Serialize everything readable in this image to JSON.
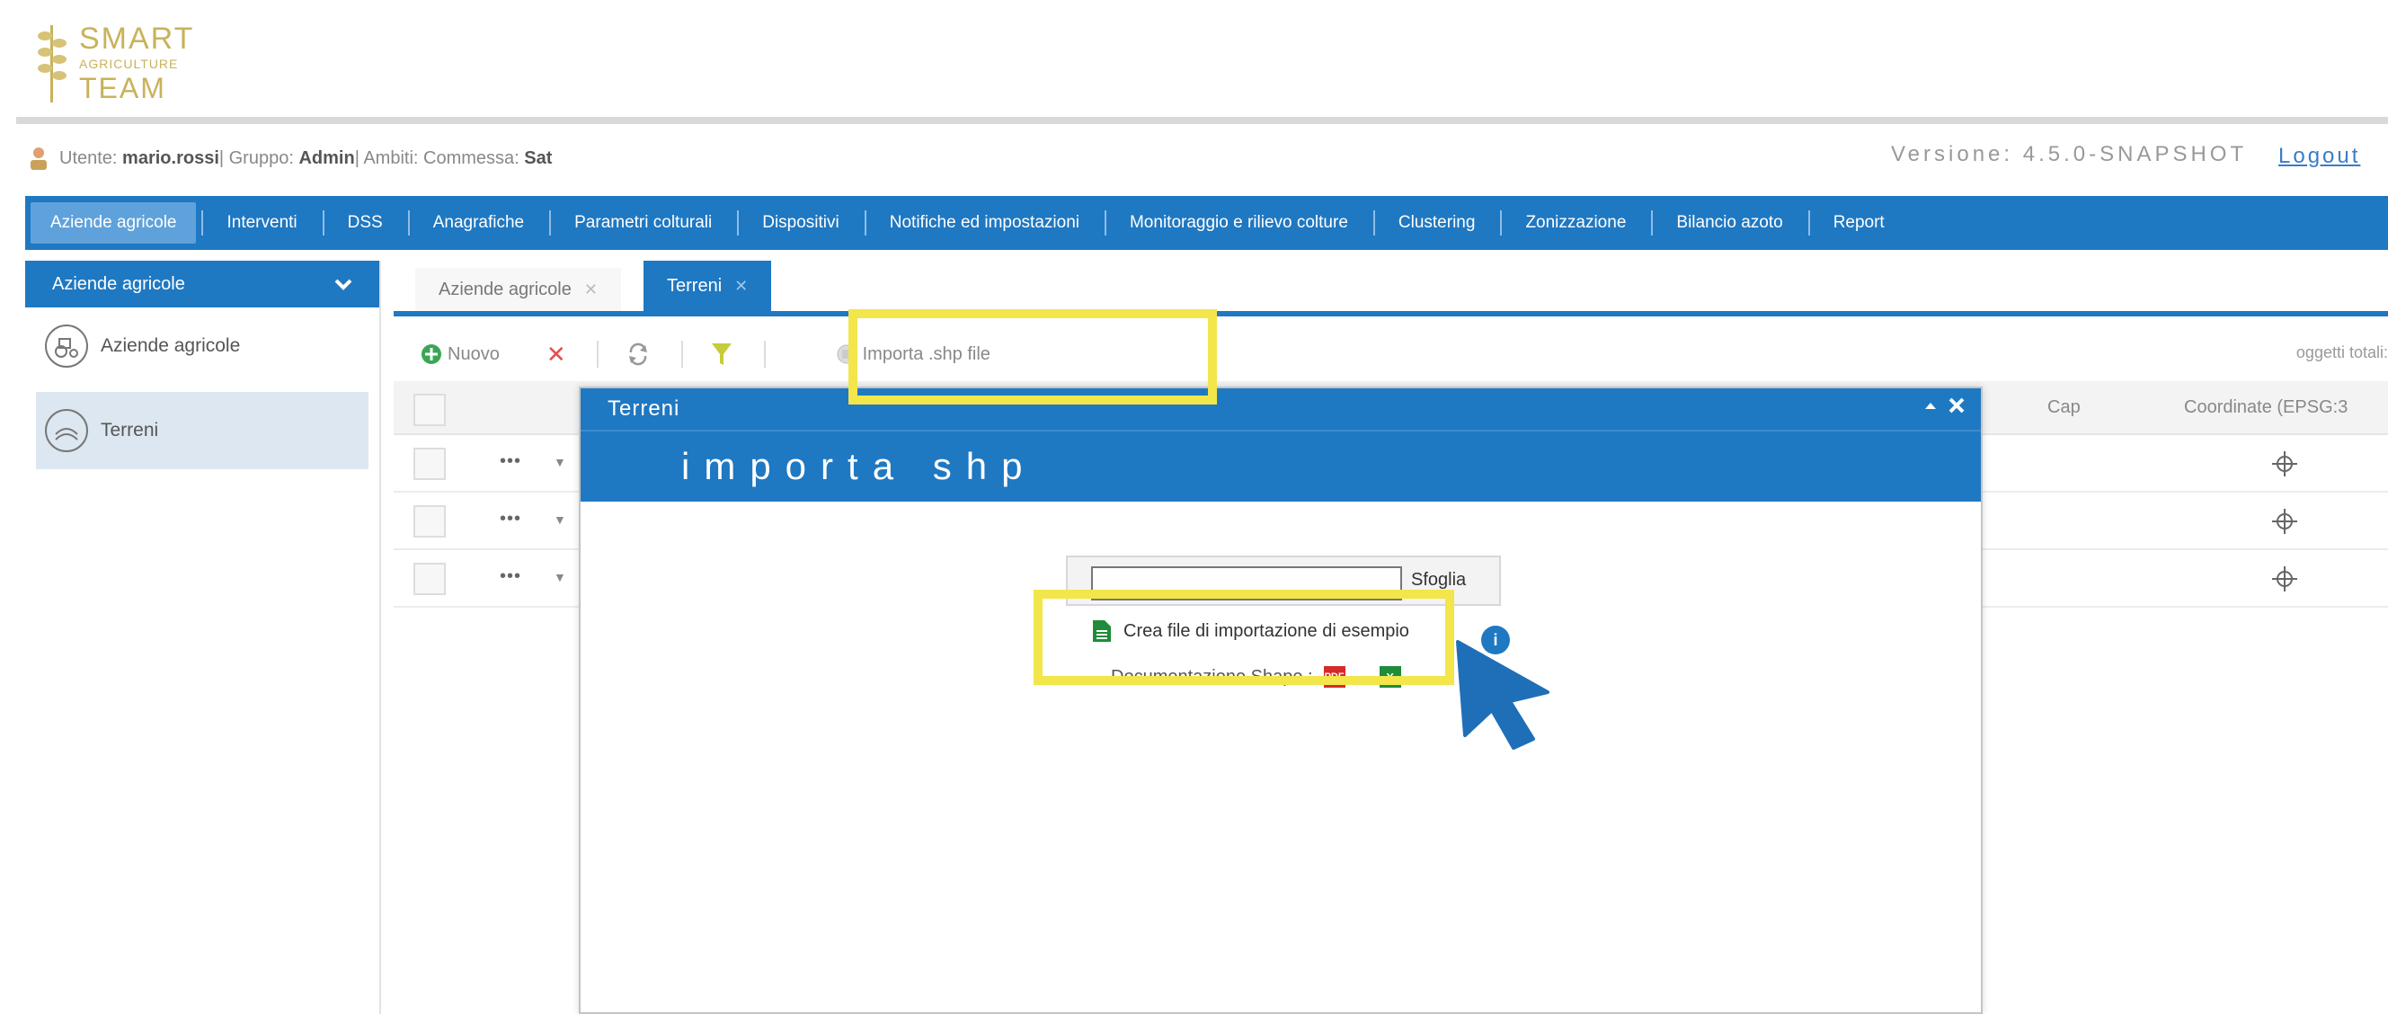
{
  "logo": {
    "line1": "SMART",
    "line2": "AGRICULTURE",
    "line3": "TEAM"
  },
  "userbar": {
    "user_label": "Utente:",
    "user_value": "mario.rossi",
    "group_label": " | Gruppo:",
    "group_value": "Admin",
    "ambiti_label": " | Ambiti: Commessa:",
    "ambiti_value": "Sat",
    "version": "Versione: 4.5.0-SNAPSHOT",
    "logout": "Logout"
  },
  "nav": {
    "items": [
      "Aziende agricole",
      "Interventi",
      "DSS",
      "Anagrafiche",
      "Parametri colturali",
      "Dispositivi",
      "Notifiche ed impostazioni",
      "Monitoraggio e rilievo colture",
      "Clustering",
      "Zonizzazione",
      "Bilancio azoto",
      "Report"
    ]
  },
  "sidebar": {
    "header": "Aziende agricole",
    "items": [
      {
        "label": "Aziende agricole"
      },
      {
        "label": "Terreni"
      }
    ]
  },
  "tabs": [
    {
      "label": "Aziende agricole"
    },
    {
      "label": "Terreni"
    }
  ],
  "toolbar": {
    "new_label": "Nuovo",
    "import_label": "Importa .shp file",
    "oggetti_label": "oggetti totali:"
  },
  "grid": {
    "columns": {
      "cap": "Cap",
      "coord": "Coordinate (EPSG:3"
    },
    "rows": [
      {
        "actions": "•••"
      },
      {
        "actions": "•••"
      },
      {
        "actions": "•••"
      }
    ]
  },
  "dialog": {
    "title": "Terreni",
    "banner": "importa shp",
    "file_value": "",
    "browse_label": "Sfoglia",
    "create_example_label": "Crea file di importazione di esempio",
    "info_label": "i",
    "doc_label": "Documentazione Shape :"
  },
  "colors": {
    "primary": "#1f78c2",
    "highlight": "#f2e64a",
    "nav_active": "#5fa2db",
    "sidebar_selected": "#dde7f1"
  },
  "icons": {
    "new": "plus-circle-icon",
    "delete": "x-icon",
    "refresh": "refresh-icon",
    "filter": "filter-icon",
    "import": "upload-icon",
    "coordinates": "crosshair-icon",
    "sheet": "spreadsheet-icon",
    "pdf": "pdf-icon",
    "excel": "excel-icon",
    "cursor": "arrow-cursor-icon"
  }
}
